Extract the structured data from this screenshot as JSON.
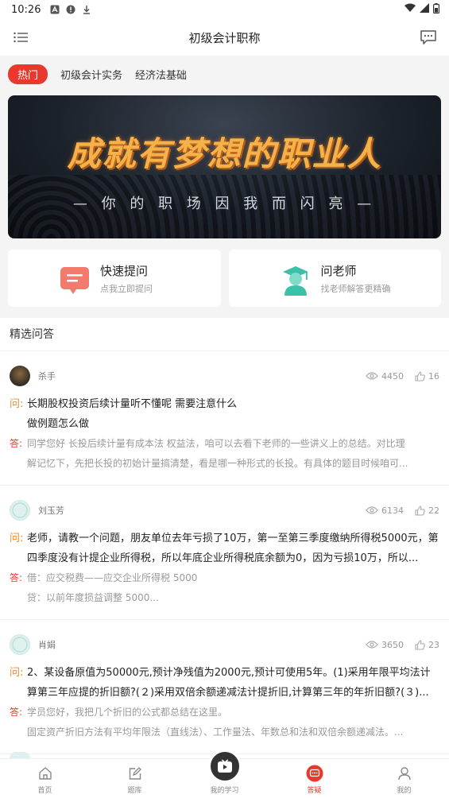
{
  "status_bar": {
    "time": "10:26"
  },
  "header": {
    "title": "初级会计职称"
  },
  "tabs": [
    {
      "label": "热门",
      "active": true
    },
    {
      "label": "初级会计实务",
      "active": false
    },
    {
      "label": "经济法基础",
      "active": false
    }
  ],
  "banner": {
    "slogan": "成就有梦想的职业人",
    "subtitle": "— 你 的 职 场 因 我 而 闪 亮 —"
  },
  "quick_cards": [
    {
      "title": "快速提问",
      "subtitle": "点我立即提问",
      "icon": "chat-bubble-icon"
    },
    {
      "title": "问老师",
      "subtitle": "找老师解答更精确",
      "icon": "teacher-icon"
    }
  ],
  "section": {
    "title": "精选问答"
  },
  "qa_marks": {
    "question": "问:",
    "answer": "答:"
  },
  "qa_items": [
    {
      "user": "杀手",
      "views": "4450",
      "likes": "16",
      "question": "长期股权投资后续计量听不懂呢 需要注意什么\n做例题怎么做",
      "answer_lines": [
        "同学您好 长投后续计量有成本法 权益法，咱可以去看下老师的一些讲义上的总结。对比理",
        "解记忆下，先把长投的初始计量搞清楚，看是哪一种形式的长投。有具体的题目时候咱可..."
      ]
    },
    {
      "user": "刘玉芳",
      "views": "6134",
      "likes": "22",
      "question": "老师，请教一个问题，朋友单位去年亏损了10万，第一至第三季度缴纳所得税5000元，第四季度没有计提企业所得税，所以年底企业所得税底余额为0，因为亏损10万，所以...",
      "answer_lines": [
        "借：应交税费——应交企业所得税   5000",
        "贷：以前年度损益调整  5000..."
      ]
    },
    {
      "user": "肖娟",
      "views": "3650",
      "likes": "23",
      "question": "2、某设备原值为50000元,预计净残值为2000元,预计可使用5年。(1)采用年限平均法计算第三年应提的折旧额?(２)采用双倍余额递减法计提折旧,计算第三年的年折旧额?(３)...",
      "answer_lines": [
        "学员您好，我把几个折旧的公式都总结在这里。",
        "固定资产折旧方法有平均年限法（直线法）、工作量法、年数总和法和双倍余额递减法。..."
      ]
    }
  ],
  "nav": [
    {
      "label": "首页",
      "icon": "home-icon",
      "active": false
    },
    {
      "label": "题库",
      "icon": "edit-icon",
      "active": false
    },
    {
      "label": "我的学习",
      "icon": "play-icon",
      "active": false
    },
    {
      "label": "答疑",
      "icon": "chat-icon",
      "active": true
    },
    {
      "label": "我的",
      "icon": "user-icon",
      "active": false
    }
  ],
  "colors": {
    "accent": "#e8392c",
    "question_mark": "#f08c1e"
  }
}
